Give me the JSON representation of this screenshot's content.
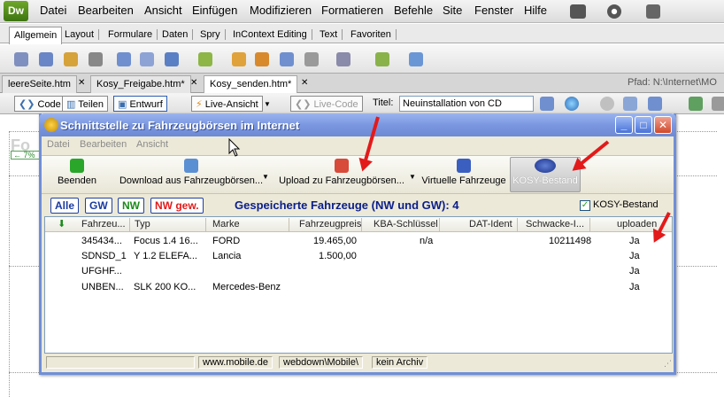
{
  "app": {
    "logo": "Dw",
    "menu": [
      "Datei",
      "Bearbeiten",
      "Ansicht",
      "Einfügen",
      "Modifizieren",
      "Formatieren",
      "Befehle",
      "Site",
      "Fenster",
      "Hilfe"
    ]
  },
  "insert_tabs": [
    "Allgemein",
    "Layout",
    "Formulare",
    "Daten",
    "Spry",
    "InContext Editing",
    "Text",
    "Favoriten"
  ],
  "document_tabs": [
    "leereSeite.htm",
    "Kosy_Freigabe.htm*",
    "Kosy_senden.htm*"
  ],
  "path": "Pfad:  N:\\Internet\\MO",
  "doc_toolbar": {
    "code": "Code",
    "split": "Teilen",
    "design": "Entwurf",
    "live_view": "Live-Ansicht",
    "live_code": "Live-Code",
    "title_label": "Titel:",
    "title_value": "Neuinstallation von CD"
  },
  "design_view": {
    "fragment_text": "Fo",
    "zoom": "7%"
  },
  "dialog": {
    "title": "Schnittstelle zu Fahrzeugbörsen im Internet",
    "menu": [
      "Datei",
      "Bearbeiten",
      "Ansicht"
    ],
    "toolbar": {
      "exit": "Beenden",
      "download": "Download aus Fahrzeugbörsen...",
      "upload": "Upload zu Fahrzeugbörsen...",
      "virtual": "Virtuelle Fahrzeuge",
      "kosy": "KOSY-Bestand"
    },
    "filters": [
      "Alle",
      "GW",
      "NW",
      "NW gew."
    ],
    "grid_title": "Gespeicherte Fahrzeuge (NW und GW): 4",
    "kosy_checkbox_label": "KOSY-Bestand",
    "kosy_checkbox_checked": true,
    "columns": [
      "Fahrzeu...",
      "Typ",
      "Marke",
      "Fahrzeugpreis",
      "KBA-Schlüssel",
      "DAT-Ident",
      "Schwacke-I...",
      "uploaden"
    ],
    "rows": [
      [
        "345434...",
        "Focus 1.4 16...",
        "FORD",
        "19.465,00",
        "n/a",
        "",
        "10211498",
        "Ja"
      ],
      [
        "SDNSD_1",
        "Y 1.2 ELEFA...",
        "Lancia",
        "1.500,00",
        "",
        "",
        "",
        "Ja"
      ],
      [
        "UFGHF...",
        "",
        "",
        "",
        "",
        "",
        "",
        "Ja"
      ],
      [
        "UNBEN...",
        "SLK 200 KO...",
        "Mercedes-Benz",
        "",
        "",
        "",
        "",
        "Ja"
      ]
    ],
    "status": [
      "www.mobile.de",
      "webdown\\Mobile\\",
      "kein Archiv"
    ]
  },
  "colors": {
    "dialog_title": "#7b97e0",
    "annotation_arrow": "#e31a1a",
    "grid_title": "#0a1e8a",
    "nw_gew_button": "#e31a1a",
    "nw_button": "#1a8a1a"
  }
}
